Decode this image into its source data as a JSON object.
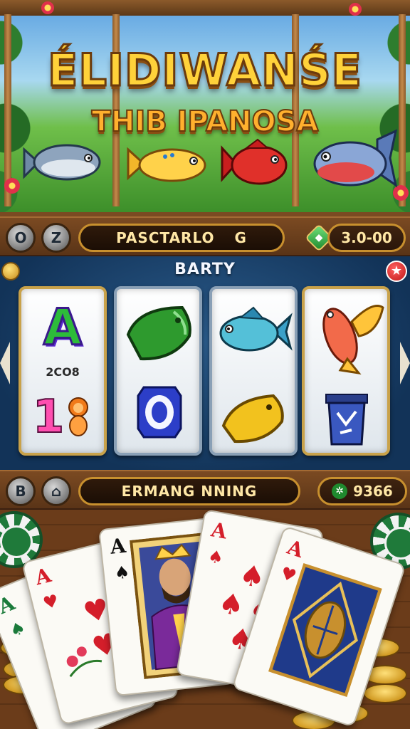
{
  "banner": {
    "title": "ÉLIDIWANŚE",
    "subtitle": "THIB IPANOSA"
  },
  "top_bar": {
    "left_buttons": [
      "O",
      "Z"
    ],
    "player_name": "PASCTARLO",
    "player_badge": "G",
    "gem_label": "◆",
    "balance": "3.0-00"
  },
  "slot": {
    "header": "BARTY",
    "star_icon": "★",
    "reels": [
      {
        "top_symbol": "A",
        "middle_label": "2CO8",
        "bottom_symbol": "1"
      },
      {
        "top_symbol": "green-fish-head",
        "bottom_symbol": "O"
      },
      {
        "top_symbol": "blue-fish",
        "bottom_symbol": "gold-fish-head"
      },
      {
        "top_symbol": "red-koi-fish",
        "bottom_symbol": "trash-bin"
      }
    ]
  },
  "bottom_bar": {
    "left_buttons": [
      "B",
      "⌂"
    ],
    "status_text": "ERMANG NNING",
    "chip_icon": "✲",
    "win_amount": "9366"
  },
  "cards": [
    {
      "rank": "A",
      "suit": "♠",
      "color": "#1a7a3a"
    },
    {
      "rank": "A",
      "suit": "♥",
      "color": "#d41e2a"
    },
    {
      "rank": "A",
      "suit": "♠",
      "color": "#111111"
    },
    {
      "rank": "A",
      "suit": "♠",
      "color": "#d41e2a"
    },
    {
      "rank": "A",
      "suit": "♥",
      "color": "#d41e2a"
    }
  ],
  "colors": {
    "wood": "#7b4a22",
    "gold_border": "#c8902e",
    "slot_blue": "#123358",
    "title_yellow": "#ffd23a"
  }
}
